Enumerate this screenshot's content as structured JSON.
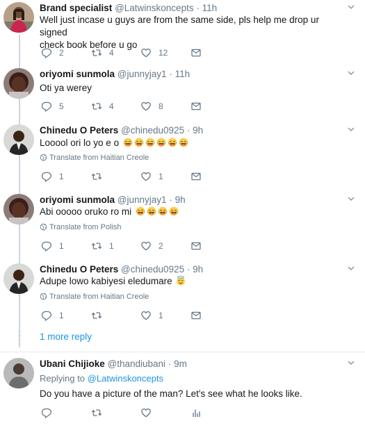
{
  "tweets": [
    {
      "name": "Brand specialist",
      "handle": "@Latwinskoncepts",
      "dot": "·",
      "time": "11h",
      "text_line1": "Well just incase u guys are from the same side, pls help me drop ur signed",
      "text_line2": "check book before u go",
      "replies": "2",
      "retweets": "4",
      "likes": "12"
    },
    {
      "name": "oriyomi sunmola",
      "handle": "@junnyjay1",
      "dot": "·",
      "time": "11h",
      "text": "Oti ya werey",
      "replies": "5",
      "retweets": "4",
      "likes": "8"
    },
    {
      "name": "Chinedu O Peters",
      "handle": "@chinedu0925",
      "dot": "·",
      "time": "9h",
      "text": "Looool ori lo yo e o",
      "translate": "Translate from Haitian Creole",
      "replies": "1",
      "retweets": "",
      "likes": "1"
    },
    {
      "name": "oriyomi sunmola",
      "handle": "@junnyjay1",
      "dot": "·",
      "time": "9h",
      "text": "Abi ooooo oruko ro mi",
      "translate": "Translate from Polish",
      "replies": "1",
      "retweets": "1",
      "likes": "2"
    },
    {
      "name": "Chinedu O Peters",
      "handle": "@chinedu0925",
      "dot": "·",
      "time": "9h",
      "text": "Adupe lowo kabiyesi eledumare",
      "translate": "Translate from Haitian Creole",
      "replies": "1",
      "retweets": "",
      "likes": "1"
    },
    {
      "name": "Ubani Chijioke",
      "handle": "@thandiubani",
      "dot": "·",
      "time": "9m",
      "replying_prefix": "Replying to",
      "replying_to": "@Latwinskoncepts",
      "text": "Do you have a picture of the man? Let's see what he looks like."
    }
  ],
  "more_reply": "1 more reply",
  "colors": {
    "text": "#14171a",
    "muted": "#657786",
    "link": "#1b95e0",
    "thread_line": "#ccd6dd",
    "icon": "#657786"
  }
}
